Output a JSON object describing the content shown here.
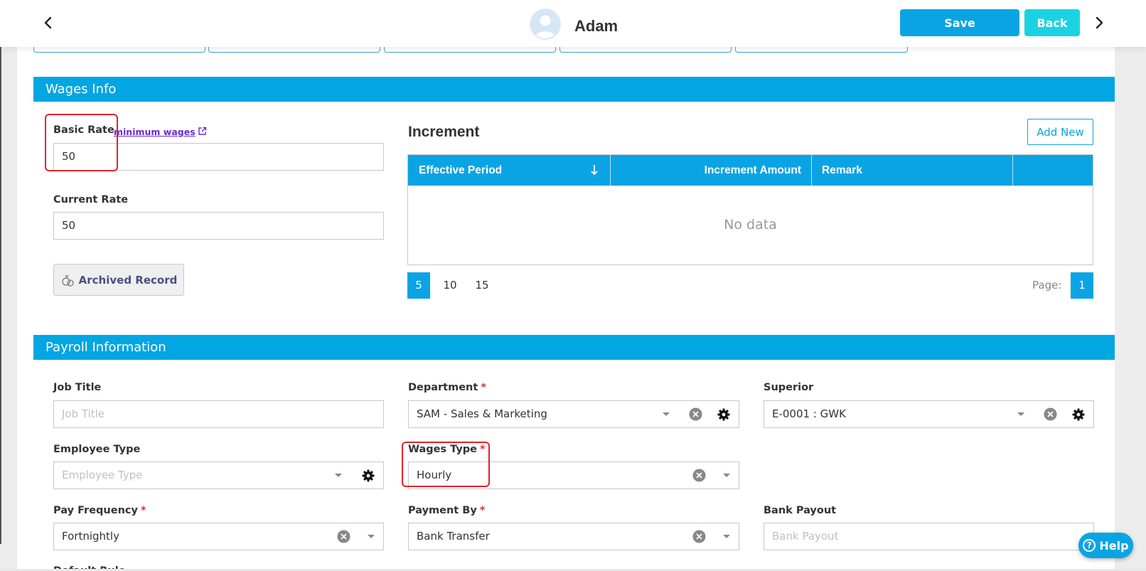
{
  "header": {
    "user_name": "Adam",
    "save_label": "Save",
    "back_label": "Back"
  },
  "wages_info": {
    "section_title": "Wages Info",
    "basic_rate_label": "Basic Rate",
    "minimum_wages_link": "minimum wages",
    "basic_rate_value": "50",
    "current_rate_label": "Current Rate",
    "current_rate_value": "50",
    "archived_record_label": "Archived Record"
  },
  "increment": {
    "title": "Increment",
    "add_new_label": "Add New",
    "columns": [
      "Effective Period",
      "Increment Amount",
      "Remark"
    ],
    "empty_text": "No data",
    "page_sizes": [
      "5",
      "10",
      "15"
    ],
    "page_label": "Page:",
    "current_page": "1"
  },
  "payroll": {
    "section_title": "Payroll Information",
    "job_title_label": "Job Title",
    "job_title_placeholder": "Job Title",
    "department_label": "Department",
    "department_value": "SAM - Sales & Marketing",
    "superior_label": "Superior",
    "superior_value": "E-0001 : GWK",
    "employee_type_label": "Employee Type",
    "employee_type_placeholder": "Employee Type",
    "wages_type_label": "Wages Type",
    "wages_type_value": "Hourly",
    "pay_frequency_label": "Pay Frequency",
    "pay_frequency_value": "Fortnightly",
    "payment_by_label": "Payment By",
    "payment_by_value": "Bank Transfer",
    "bank_payout_label": "Bank Payout",
    "bank_payout_placeholder": "Bank Payout",
    "default_rule_label": "Default Rule",
    "required_mark": "*"
  },
  "help": {
    "label": "Help",
    "icon_char": "?"
  },
  "colors": {
    "primary": "#0aa4e4",
    "section_bar": "#02a6e3",
    "back_button": "#1ad3e2",
    "highlight": "#e2232a"
  }
}
